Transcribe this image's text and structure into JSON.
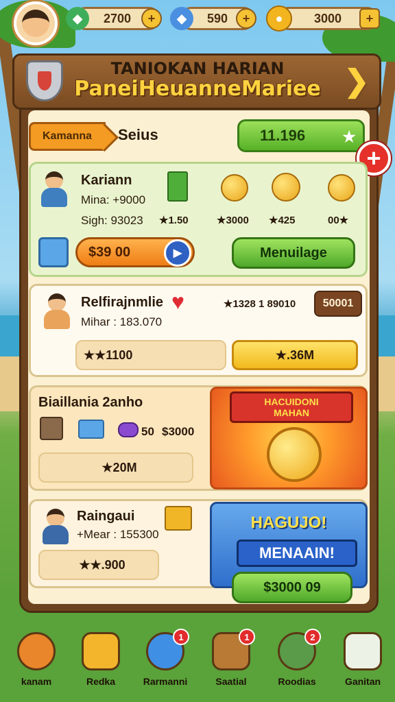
{
  "topbar": {
    "resources": [
      {
        "icon": "green-gem-icon",
        "value": "2700",
        "action": "+"
      },
      {
        "icon": "blue-crystal-icon",
        "value": "590",
        "action": "+"
      },
      {
        "icon": "gold-coin-icon",
        "value": "3000",
        "action": "+"
      }
    ]
  },
  "header": {
    "line1": "TANIOKAN HARIAN",
    "line2": "PaneiHeuanneMariee"
  },
  "filter": {
    "tag_label": "Kamanna",
    "set_label": "Seius",
    "total_value": "11.196"
  },
  "cards": [
    {
      "name": "Kariann",
      "line1": "Mina: +9000",
      "line2": "Sigh: 93023",
      "rewards": [
        "★1.50",
        "★3000",
        "★425",
        "00★"
      ],
      "primary_button": "$39 00",
      "secondary_button": "Menuilage"
    },
    {
      "name": "Relfirajnmlie",
      "line1": "Mihar : 183.070",
      "stars_value": "★1328 1 89010",
      "price": "50001",
      "left_bar": "★★1100",
      "right_bar": "★.36M"
    },
    {
      "name": "Biaillania 2anho",
      "inline_values": [
        "50",
        "$3000"
      ],
      "bar": "★20M",
      "promo_line1": "HACUIDONI",
      "promo_line2": "MAHAN"
    },
    {
      "name": "Raingaui",
      "line1": "+Mear : 155300",
      "bar": "★★.900",
      "promo_title": "HAGUJO!",
      "promo_ribbon": "MENAAIN!",
      "promo_button": "$3000 09"
    }
  ],
  "nav": [
    {
      "icon": "shield-coin-icon",
      "label": "kanam",
      "badge": ""
    },
    {
      "icon": "treasure-box-icon",
      "label": "Redka",
      "badge": ""
    },
    {
      "icon": "globe-icon",
      "label": "Rarmanni",
      "badge": "1"
    },
    {
      "icon": "sword-icon",
      "label": "Saatial",
      "badge": "1"
    },
    {
      "icon": "helmet-icon",
      "label": "Roodias",
      "badge": "2"
    },
    {
      "icon": "calendar-icon",
      "label": "Ganitan",
      "badge": ""
    }
  ]
}
